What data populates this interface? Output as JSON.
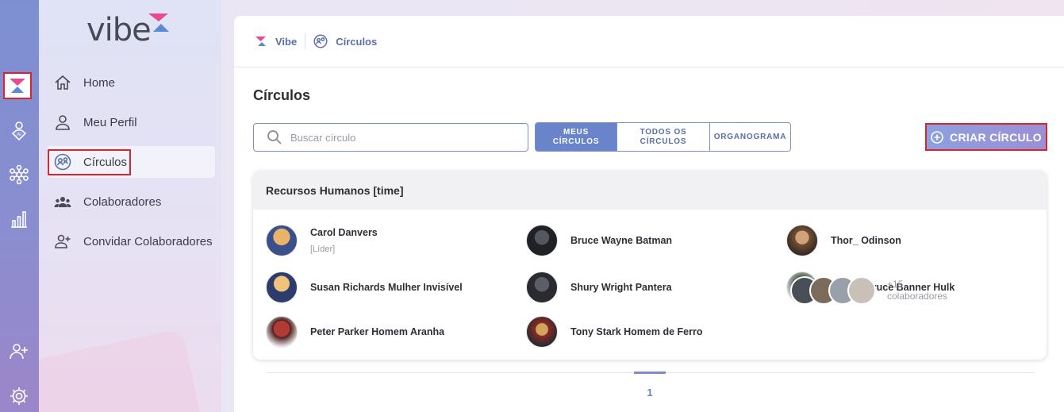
{
  "brand": {
    "name": "vibe"
  },
  "rail": {
    "items": [
      {
        "icon": "vibe-logo-icon"
      },
      {
        "icon": "ai-location-icon"
      },
      {
        "icon": "network-icon"
      },
      {
        "icon": "bar-chart-icon"
      },
      {
        "icon": "add-user-icon"
      },
      {
        "icon": "gear-icon"
      }
    ]
  },
  "sidebar": {
    "items": [
      {
        "label": "Home",
        "icon": "home-icon"
      },
      {
        "label": "Meu Perfil",
        "icon": "user-icon"
      },
      {
        "label": "Círculos",
        "icon": "circles-icon",
        "active": true
      },
      {
        "label": "Colaboradores",
        "icon": "group-icon"
      },
      {
        "label": "Convidar Colaboradores",
        "icon": "invite-user-icon"
      }
    ]
  },
  "breadcrumb": {
    "root": "Vibe",
    "current": "Círculos"
  },
  "page": {
    "title": "Círculos",
    "search_placeholder": "Buscar círculo",
    "tabs": [
      {
        "line1": "MEUS",
        "line2": "CÍRCULOS",
        "active": true
      },
      {
        "line1": "TODOS OS",
        "line2": "CÍRCULOS",
        "active": false
      },
      {
        "line1": "ORGANOGRAMA",
        "line2": "",
        "active": false
      }
    ],
    "create_button": "CRIAR CÍRCULO"
  },
  "circle": {
    "title": "Recursos Humanos [time]",
    "members": [
      {
        "name": "Carol Danvers",
        "role": "[Líder]",
        "color": "#c2803a"
      },
      {
        "name": "Bruce Wayne Batman",
        "role": "",
        "color": "#2a2c33"
      },
      {
        "name": "Thor_ Odinson",
        "role": "",
        "color": "#7a5a3a"
      },
      {
        "name": "Susan Richards Mulher Invisível",
        "role": "",
        "color": "#c89a52"
      },
      {
        "name": "Shury Wright Pantera",
        "role": "",
        "color": "#3a3c44"
      },
      {
        "name": "Robert Bruce Banner Hulk",
        "role": "",
        "color": "#5f7a5a"
      },
      {
        "name": "Peter Parker Homem Aranha",
        "role": "",
        "color": "#9c2e2a"
      },
      {
        "name": "Tony Stark Homem de Ferro",
        "role": "",
        "color": "#7a2a26"
      }
    ],
    "more_count": "+15",
    "more_label": "colaboradores",
    "stack_colors": [
      "#4a4e57",
      "#7c6a5a",
      "#9aa0aa",
      "#c9c0b8"
    ]
  },
  "pagination": {
    "current": "1"
  },
  "colors": {
    "accent": "#6a84cc",
    "brand_pink": "#e84a8f",
    "brand_blue": "#5a8ad6",
    "highlight": "#d9262e"
  }
}
